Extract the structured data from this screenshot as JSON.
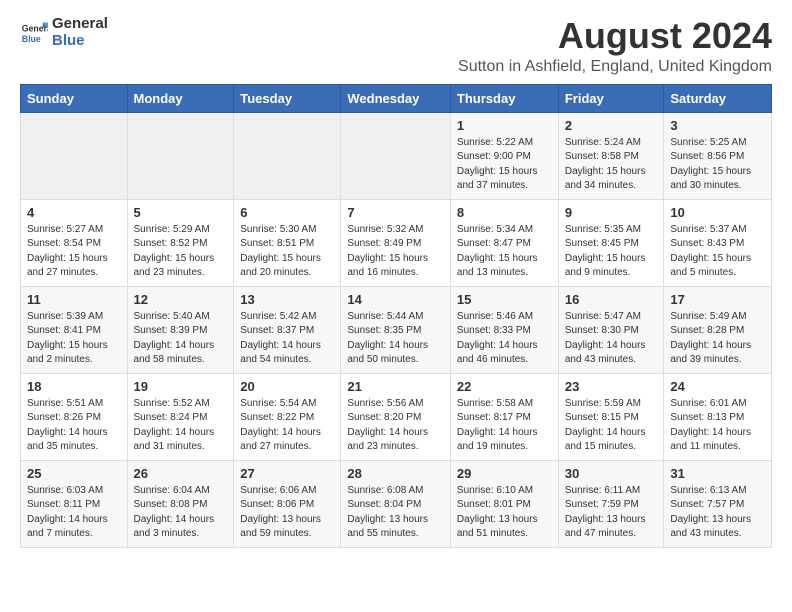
{
  "header": {
    "logo_general": "General",
    "logo_blue": "Blue",
    "title": "August 2024",
    "subtitle": "Sutton in Ashfield, England, United Kingdom"
  },
  "weekdays": [
    "Sunday",
    "Monday",
    "Tuesday",
    "Wednesday",
    "Thursday",
    "Friday",
    "Saturday"
  ],
  "weeks": [
    [
      {
        "day": "",
        "info": ""
      },
      {
        "day": "",
        "info": ""
      },
      {
        "day": "",
        "info": ""
      },
      {
        "day": "",
        "info": ""
      },
      {
        "day": "1",
        "info": "Sunrise: 5:22 AM\nSunset: 9:00 PM\nDaylight: 15 hours\nand 37 minutes."
      },
      {
        "day": "2",
        "info": "Sunrise: 5:24 AM\nSunset: 8:58 PM\nDaylight: 15 hours\nand 34 minutes."
      },
      {
        "day": "3",
        "info": "Sunrise: 5:25 AM\nSunset: 8:56 PM\nDaylight: 15 hours\nand 30 minutes."
      }
    ],
    [
      {
        "day": "4",
        "info": "Sunrise: 5:27 AM\nSunset: 8:54 PM\nDaylight: 15 hours\nand 27 minutes."
      },
      {
        "day": "5",
        "info": "Sunrise: 5:29 AM\nSunset: 8:52 PM\nDaylight: 15 hours\nand 23 minutes."
      },
      {
        "day": "6",
        "info": "Sunrise: 5:30 AM\nSunset: 8:51 PM\nDaylight: 15 hours\nand 20 minutes."
      },
      {
        "day": "7",
        "info": "Sunrise: 5:32 AM\nSunset: 8:49 PM\nDaylight: 15 hours\nand 16 minutes."
      },
      {
        "day": "8",
        "info": "Sunrise: 5:34 AM\nSunset: 8:47 PM\nDaylight: 15 hours\nand 13 minutes."
      },
      {
        "day": "9",
        "info": "Sunrise: 5:35 AM\nSunset: 8:45 PM\nDaylight: 15 hours\nand 9 minutes."
      },
      {
        "day": "10",
        "info": "Sunrise: 5:37 AM\nSunset: 8:43 PM\nDaylight: 15 hours\nand 5 minutes."
      }
    ],
    [
      {
        "day": "11",
        "info": "Sunrise: 5:39 AM\nSunset: 8:41 PM\nDaylight: 15 hours\nand 2 minutes."
      },
      {
        "day": "12",
        "info": "Sunrise: 5:40 AM\nSunset: 8:39 PM\nDaylight: 14 hours\nand 58 minutes."
      },
      {
        "day": "13",
        "info": "Sunrise: 5:42 AM\nSunset: 8:37 PM\nDaylight: 14 hours\nand 54 minutes."
      },
      {
        "day": "14",
        "info": "Sunrise: 5:44 AM\nSunset: 8:35 PM\nDaylight: 14 hours\nand 50 minutes."
      },
      {
        "day": "15",
        "info": "Sunrise: 5:46 AM\nSunset: 8:33 PM\nDaylight: 14 hours\nand 46 minutes."
      },
      {
        "day": "16",
        "info": "Sunrise: 5:47 AM\nSunset: 8:30 PM\nDaylight: 14 hours\nand 43 minutes."
      },
      {
        "day": "17",
        "info": "Sunrise: 5:49 AM\nSunset: 8:28 PM\nDaylight: 14 hours\nand 39 minutes."
      }
    ],
    [
      {
        "day": "18",
        "info": "Sunrise: 5:51 AM\nSunset: 8:26 PM\nDaylight: 14 hours\nand 35 minutes."
      },
      {
        "day": "19",
        "info": "Sunrise: 5:52 AM\nSunset: 8:24 PM\nDaylight: 14 hours\nand 31 minutes."
      },
      {
        "day": "20",
        "info": "Sunrise: 5:54 AM\nSunset: 8:22 PM\nDaylight: 14 hours\nand 27 minutes."
      },
      {
        "day": "21",
        "info": "Sunrise: 5:56 AM\nSunset: 8:20 PM\nDaylight: 14 hours\nand 23 minutes."
      },
      {
        "day": "22",
        "info": "Sunrise: 5:58 AM\nSunset: 8:17 PM\nDaylight: 14 hours\nand 19 minutes."
      },
      {
        "day": "23",
        "info": "Sunrise: 5:59 AM\nSunset: 8:15 PM\nDaylight: 14 hours\nand 15 minutes."
      },
      {
        "day": "24",
        "info": "Sunrise: 6:01 AM\nSunset: 8:13 PM\nDaylight: 14 hours\nand 11 minutes."
      }
    ],
    [
      {
        "day": "25",
        "info": "Sunrise: 6:03 AM\nSunset: 8:11 PM\nDaylight: 14 hours\nand 7 minutes."
      },
      {
        "day": "26",
        "info": "Sunrise: 6:04 AM\nSunset: 8:08 PM\nDaylight: 14 hours\nand 3 minutes."
      },
      {
        "day": "27",
        "info": "Sunrise: 6:06 AM\nSunset: 8:06 PM\nDaylight: 13 hours\nand 59 minutes."
      },
      {
        "day": "28",
        "info": "Sunrise: 6:08 AM\nSunset: 8:04 PM\nDaylight: 13 hours\nand 55 minutes."
      },
      {
        "day": "29",
        "info": "Sunrise: 6:10 AM\nSunset: 8:01 PM\nDaylight: 13 hours\nand 51 minutes."
      },
      {
        "day": "30",
        "info": "Sunrise: 6:11 AM\nSunset: 7:59 PM\nDaylight: 13 hours\nand 47 minutes."
      },
      {
        "day": "31",
        "info": "Sunrise: 6:13 AM\nSunset: 7:57 PM\nDaylight: 13 hours\nand 43 minutes."
      }
    ]
  ]
}
